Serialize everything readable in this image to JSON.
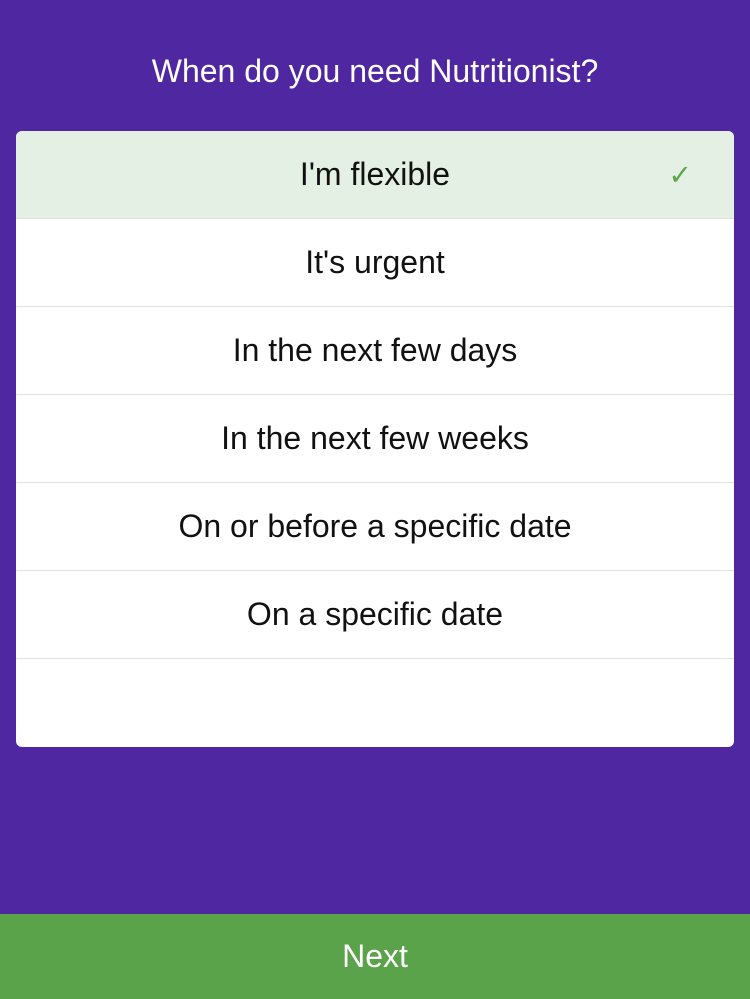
{
  "header": {
    "title": "When do you need Nutritionist?"
  },
  "options": [
    {
      "label": "I'm flexible",
      "selected": true
    },
    {
      "label": "It's urgent",
      "selected": false
    },
    {
      "label": "In the next few days",
      "selected": false
    },
    {
      "label": "In the next few weeks",
      "selected": false
    },
    {
      "label": "On or before a specific date",
      "selected": false
    },
    {
      "label": "On a specific date",
      "selected": false
    }
  ],
  "selected_icon": "checkmark-icon",
  "footer": {
    "next_label": "Next"
  },
  "colors": {
    "background": "#4f27a1",
    "selected_row": "#e3f0e3",
    "check": "#5aa64a",
    "next_button": "#5ba34a"
  }
}
